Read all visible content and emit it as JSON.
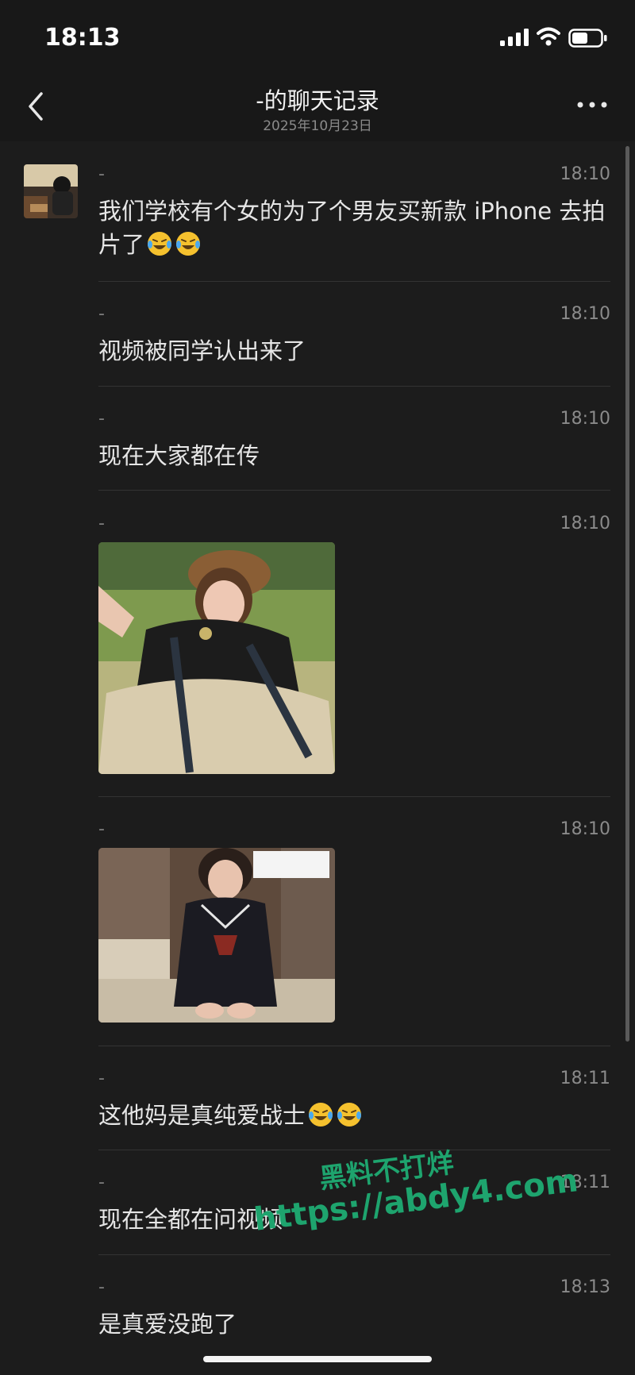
{
  "status_bar": {
    "time": "18:13"
  },
  "nav": {
    "title": "-的聊天记录",
    "subtitle": "2025年10月23日"
  },
  "messages": [
    {
      "sender": "-",
      "time": "18:10",
      "text": "我们学校有个女的为了个男友买新款 iPhone 去拍片了",
      "emoji": [
        "laughing-tears-emoji",
        "laughing-tears-emoji"
      ]
    },
    {
      "sender": "-",
      "time": "18:10",
      "text": "视频被同学认出来了"
    },
    {
      "sender": "-",
      "time": "18:10",
      "text": "现在大家都在传"
    },
    {
      "sender": "-",
      "time": "18:10",
      "image": "photo-girl-beret-outdoor"
    },
    {
      "sender": "-",
      "time": "18:10",
      "image": "photo-girl-sailor-uniform"
    },
    {
      "sender": "-",
      "time": "18:11",
      "text": "这他妈是真纯爱战士",
      "emoji": [
        "laughing-tears-emoji",
        "laughing-tears-emoji"
      ]
    },
    {
      "sender": "-",
      "time": "18:11",
      "text": "现在全都在问视频"
    },
    {
      "sender": "-",
      "time": "18:13",
      "text": "是真爱没跑了"
    }
  ],
  "watermark": {
    "line1": "黑料不打烊",
    "line2": "https://abdy4.com"
  },
  "icons": {
    "back": "chevron-left-icon",
    "more": "more-dots-icon",
    "signal": "cellular-signal-icon",
    "wifi": "wifi-icon",
    "battery": "battery-icon"
  },
  "colors": {
    "background": "#1c1c1c",
    "watermark": "#1ea46e"
  }
}
